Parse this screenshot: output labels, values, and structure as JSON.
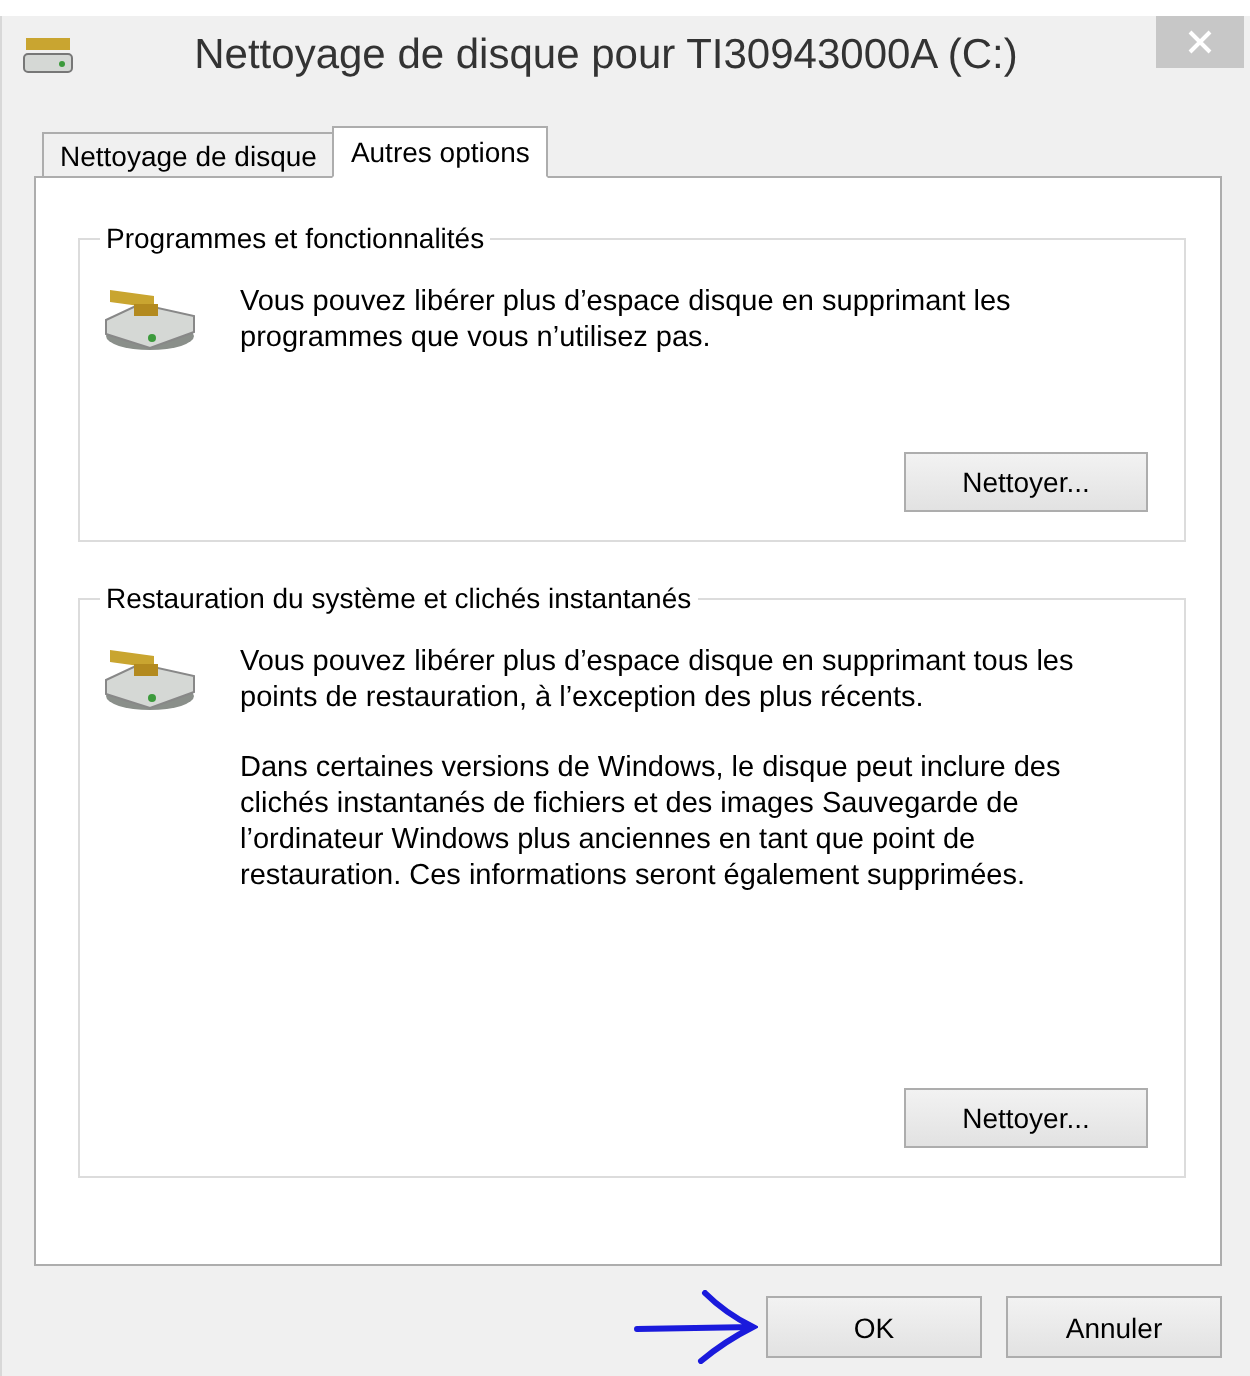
{
  "window": {
    "title": "Nettoyage de disque pour TI30943000A (C:)"
  },
  "tabs": [
    {
      "label": "Nettoyage de disque",
      "selected": false
    },
    {
      "label": "Autres options",
      "selected": true
    }
  ],
  "groups": [
    {
      "title": "Programmes et fonctionnalités",
      "paragraphs": [
        "Vous pouvez libérer plus d’espace disque en supprimant les programmes que vous n’utilisez pas."
      ],
      "button": "Nettoyer..."
    },
    {
      "title": "Restauration du système et clichés instantanés",
      "paragraphs": [
        "Vous pouvez libérer plus d’espace disque en supprimant tous les points de restauration, à l’exception des plus récents.",
        "Dans certaines versions de Windows, le disque peut inclure des clichés instantanés de fichiers et des images Sauvegarde de l’ordinateur Windows plus anciennes en tant que point de restauration. Ces informations seront également supprimées."
      ],
      "button": "Nettoyer..."
    }
  ],
  "buttons": [
    "OK",
    "Annuler"
  ]
}
